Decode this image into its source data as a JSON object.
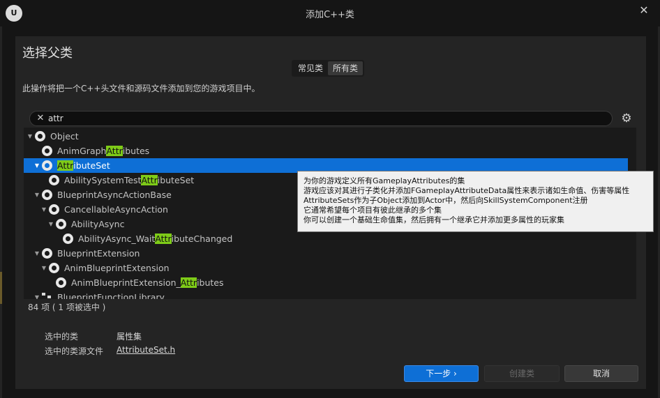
{
  "window": {
    "logo": "U",
    "title": "添加C++类",
    "close_glyph": "✕"
  },
  "dialog": {
    "heading": "选择父类",
    "tabs": [
      {
        "label": "常见类",
        "active": false
      },
      {
        "label": "所有类",
        "active": true
      }
    ],
    "description": "此操作将把一个C++头文件和源码文件添加到您的游戏项目中。"
  },
  "search": {
    "value": "attr",
    "clear_glyph": "✕",
    "settings_glyph": "⚙"
  },
  "tree": {
    "rows": [
      {
        "depth": 0,
        "expanded": true,
        "icon": "class-icon",
        "pre": "Object",
        "match": "",
        "post": "",
        "selected": false
      },
      {
        "depth": 1,
        "expanded": null,
        "icon": "class-icon",
        "pre": "AnimGraph",
        "match": "Attr",
        "post": "ibutes",
        "selected": false
      },
      {
        "depth": 1,
        "expanded": true,
        "icon": "class-icon",
        "pre": "",
        "match": "Attr",
        "post": "ibuteSet",
        "selected": true
      },
      {
        "depth": 2,
        "expanded": null,
        "icon": "class-icon",
        "pre": "AbilitySystemTest",
        "match": "Attr",
        "post": "ibuteSet",
        "selected": false
      },
      {
        "depth": 1,
        "expanded": true,
        "icon": "class-icon",
        "pre": "BlueprintAsyncActionBase",
        "match": "",
        "post": "",
        "selected": false
      },
      {
        "depth": 2,
        "expanded": true,
        "icon": "class-icon",
        "pre": "CancellableAsyncAction",
        "match": "",
        "post": "",
        "selected": false
      },
      {
        "depth": 3,
        "expanded": true,
        "icon": "class-icon",
        "pre": "AbilityAsync",
        "match": "",
        "post": "",
        "selected": false
      },
      {
        "depth": 4,
        "expanded": null,
        "icon": "class-icon",
        "pre": "AbilityAsync_Wait",
        "match": "Attr",
        "post": "ibuteChanged",
        "selected": false
      },
      {
        "depth": 1,
        "expanded": true,
        "icon": "class-icon",
        "pre": "BlueprintExtension",
        "match": "",
        "post": "",
        "selected": false
      },
      {
        "depth": 2,
        "expanded": true,
        "icon": "class-icon",
        "pre": "AnimBlueprintExtension",
        "match": "",
        "post": "",
        "selected": false
      },
      {
        "depth": 3,
        "expanded": null,
        "icon": "class-icon",
        "pre": "AnimBlueprintExtension_",
        "match": "Attr",
        "post": "ibutes",
        "selected": false
      },
      {
        "depth": 1,
        "expanded": true,
        "icon": "function-library-icon",
        "pre": "BlueprintFunctionLibrary",
        "match": "",
        "post": "",
        "selected": false
      }
    ]
  },
  "status": {
    "count_text": "84 项 ( 1 项被选中 )"
  },
  "selection": {
    "class_label": "选中的类",
    "class_value": "属性集",
    "source_label": "选中的类源文件",
    "source_value": "AttributeSet.h"
  },
  "buttons": {
    "next": "下一步 ›",
    "create": "创建类",
    "cancel": "取消"
  },
  "tooltip": {
    "lines": [
      "为你的游戏定义所有GameplayAttributes的集",
      "游戏应该对其进行子类化并添加FGameplayAttributeData属性来表示诸如生命值、伤害等属性",
      "AttributeSets作为子Object添加到Actor中，然后向SkillSystemComponent注册",
      "它通常希望每个项目有彼此继承的多个集",
      "你可以创建一个基础生命值集，然后拥有一个继承它并添加更多属性的玩家集"
    ]
  },
  "colors": {
    "selection": "#0e6fd6",
    "match_highlight": "#7ecb18",
    "background": "#242424"
  }
}
